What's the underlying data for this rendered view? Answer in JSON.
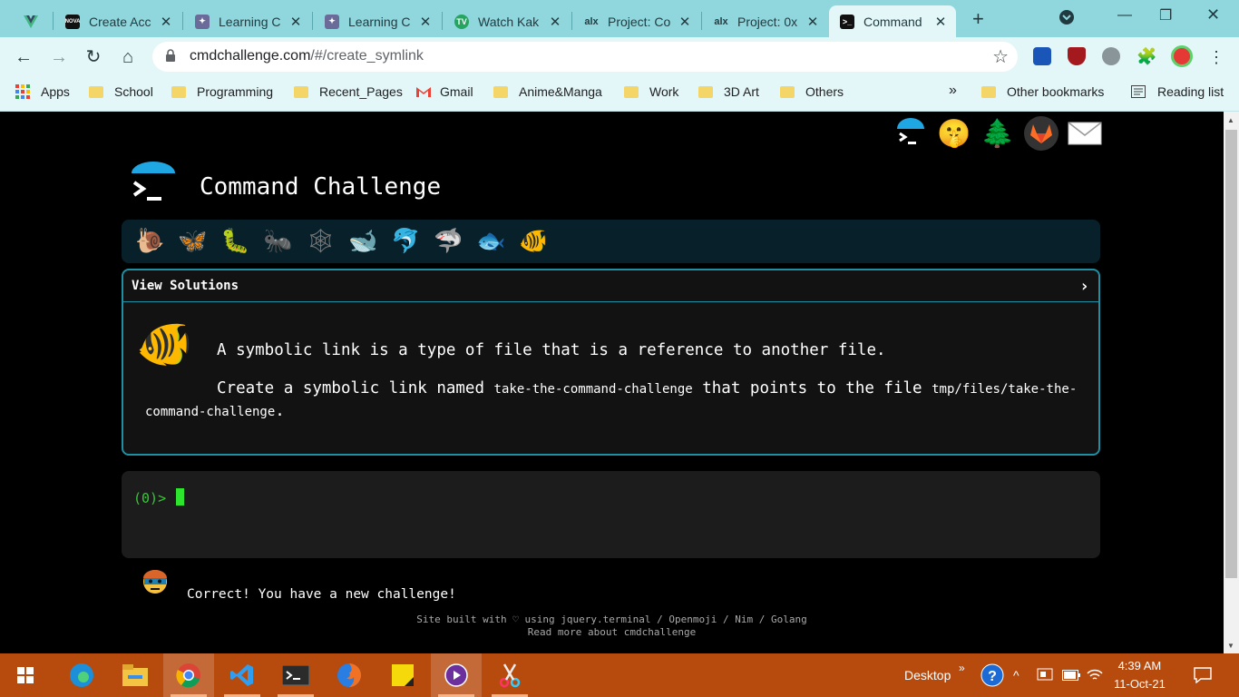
{
  "tabs": [
    {
      "title": "",
      "icon": "vue-icon"
    },
    {
      "title": "Create Acc",
      "icon": "nova-icon"
    },
    {
      "title": "Learning C",
      "icon": "learning-icon"
    },
    {
      "title": "Learning C",
      "icon": "learning-icon"
    },
    {
      "title": "Watch Kak",
      "icon": "tv-icon"
    },
    {
      "title": "Project: Co",
      "icon": "alx-icon"
    },
    {
      "title": "Project: 0x",
      "icon": "alx-icon"
    },
    {
      "title": "Command",
      "icon": "terminal-icon"
    }
  ],
  "tab_favicon_labels": {
    "nova": "NOVA",
    "alx": "alx",
    "tv": "TV"
  },
  "url": {
    "host": "cmdchallenge.com",
    "path": "/#/create_symlink"
  },
  "bookmarks": {
    "apps": "Apps",
    "items": [
      "School",
      "Programming",
      "Recent_Pages",
      "Gmail",
      "Anime&Manga",
      "Work",
      "3D Art",
      "Others"
    ],
    "more": "»",
    "other": "Other bookmarks",
    "reading_list": "Reading list"
  },
  "page": {
    "title": "Command Challenge",
    "panel_header": "View Solutions",
    "panel_chevron": "›",
    "intro": "A symbolic link is a type of file that is a reference to another file.",
    "task_prefix": "Create a symbolic link named ",
    "task_code1": "take-the-command-challenge",
    "task_middle": " that points to the file ",
    "task_code2": "tmp/files/take-the-command-challenge",
    "task_suffix": ".",
    "prompt": "(0)>",
    "feedback": "Correct! You have a new challenge!",
    "footer_line1": "Site built with ♡ using jquery.terminal / Openmoji / Nim / Golang",
    "footer_line2": "Read more about cmdchallenge"
  },
  "level_icons": [
    "snail-icon",
    "butterfly-icon",
    "caterpillar-icon",
    "ant-icon",
    "spider-web-icon",
    "whale-icon",
    "dolphin-icon",
    "shark-icon",
    "fish-icon",
    "tropical-fish-icon"
  ],
  "taskbar": {
    "desktop_label": "Desktop",
    "tray_more": "»",
    "time": "4:39 AM",
    "date": "11-Oct-21"
  },
  "colors": {
    "tabbar": "#8fd6dd",
    "toolbar": "#e3f6f8",
    "panel_border": "#1f8fa3",
    "prompt_green": "#35c935",
    "taskbar": "#b74a0d"
  }
}
